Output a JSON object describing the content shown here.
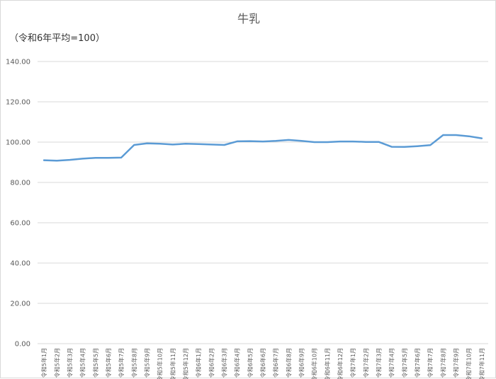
{
  "chart_data": {
    "type": "line",
    "title": "牛乳",
    "subtitle": "（令和6年平均=100）",
    "xlabel": "",
    "ylabel": "",
    "ylim": [
      0,
      140
    ],
    "yticks": [
      "0.00",
      "20.00",
      "40.00",
      "60.00",
      "80.00",
      "100.00",
      "120.00",
      "140.00"
    ],
    "grid": true,
    "categories": [
      "令和5年1月",
      "令和5年2月",
      "令和5年3月",
      "令和5年4月",
      "令和5年5月",
      "令和5年6月",
      "令和5年7月",
      "令和5年8月",
      "令和5年9月",
      "令和5年10月",
      "令和5年11月",
      "令和5年12月",
      "令和6年1月",
      "令和6年2月",
      "令和6年3月",
      "令和6年4月",
      "令和6年5月",
      "令和6年6月",
      "令和6年7月",
      "令和6年8月",
      "令和6年9月",
      "令和6年10月",
      "令和6年11月",
      "令和6年12月",
      "令和7年1月",
      "令和7年2月",
      "令和7年3月",
      "令和7年4月",
      "令和7年5月",
      "令和7年6月",
      "令和7年7月",
      "令和7年8月",
      "令和7年9月",
      "令和7年10月",
      "令和7年11月"
    ],
    "series": [
      {
        "values": [
          91.0,
          90.8,
          91.2,
          91.8,
          92.2,
          92.2,
          92.3,
          98.6,
          99.4,
          99.2,
          98.8,
          99.2,
          99.0,
          98.8,
          98.6,
          100.4,
          100.5,
          100.3,
          100.6,
          101.1,
          100.6,
          100.0,
          100.0,
          100.3,
          100.3,
          100.1,
          100.1,
          97.7,
          97.6,
          98.0,
          98.5,
          103.5,
          103.5,
          102.9,
          101.9
        ]
      }
    ],
    "colors": {
      "series": "#5b9bd5",
      "grid": "#d9d9d9",
      "text": "#595959"
    }
  }
}
